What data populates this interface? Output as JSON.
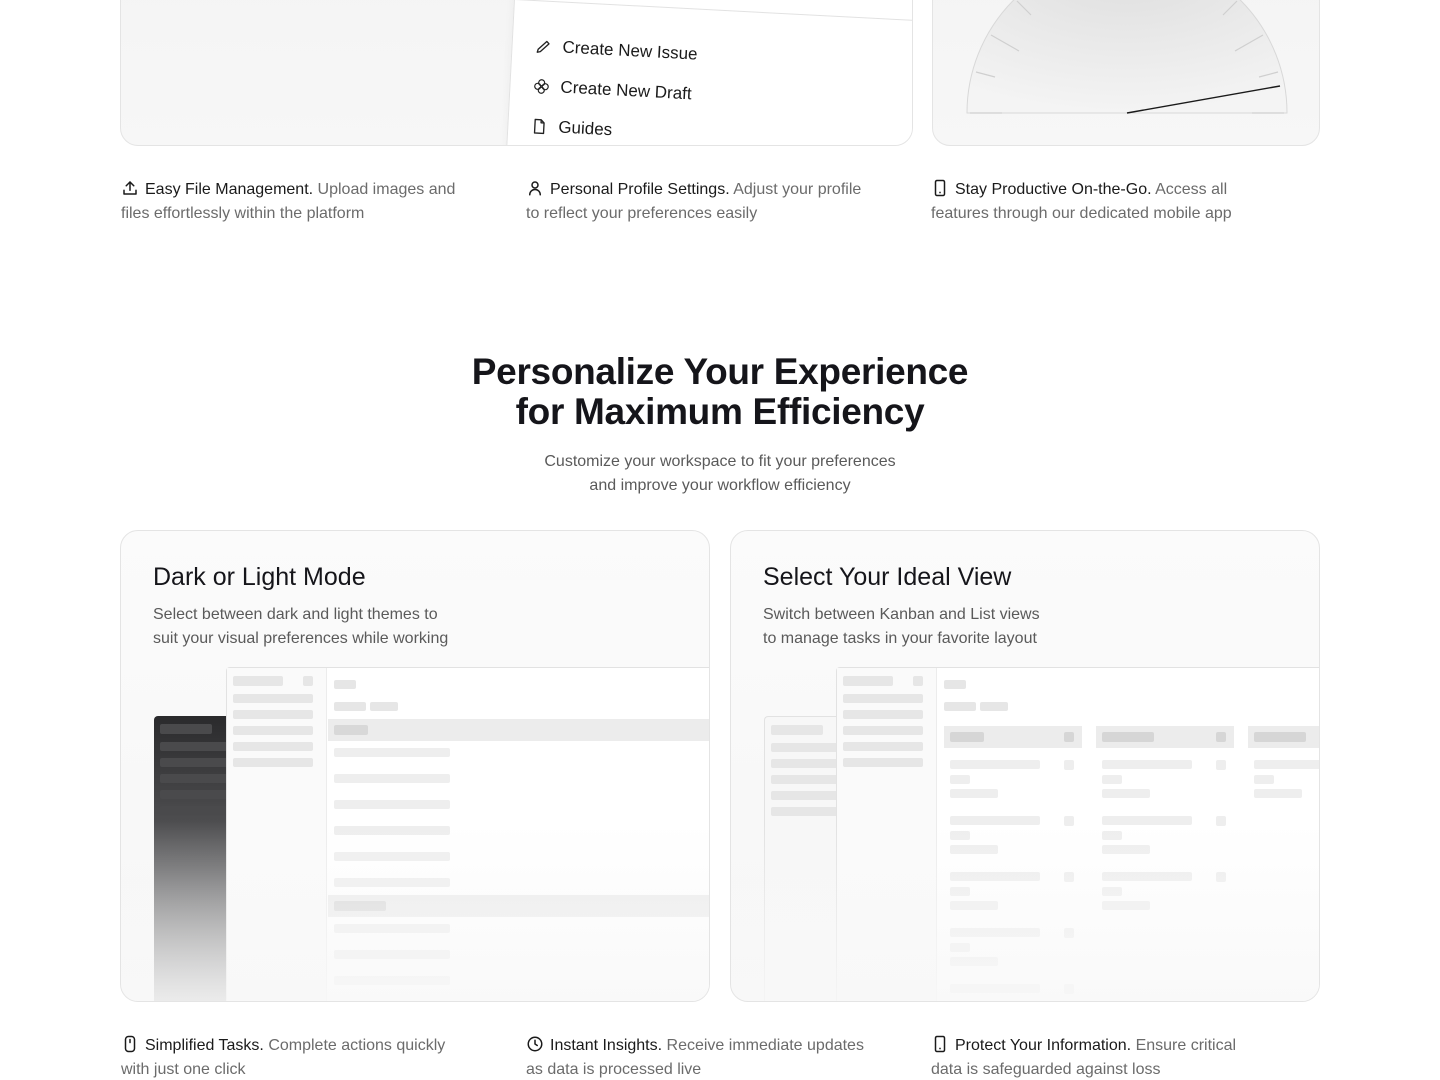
{
  "command_menu": {
    "items": [
      {
        "label": "Create New Issue",
        "icon": "pencil-icon"
      },
      {
        "label": "Create New Draft",
        "icon": "flower-icon"
      },
      {
        "label": "Guides",
        "icon": "document-icon"
      }
    ]
  },
  "top_features": [
    {
      "title": "Easy File Management.",
      "desc": "Upload images and files effortlessly within the platform",
      "icon": "upload-icon"
    },
    {
      "title": "Personal Profile Settings.",
      "desc": "Adjust your profile to reflect your preferences easily",
      "icon": "user-icon"
    },
    {
      "title": "Stay Productive On-the-Go.",
      "desc": "Access all features through our dedicated mobile app",
      "icon": "phone-icon"
    }
  ],
  "section": {
    "title_line1": "Personalize Your Experience",
    "title_line2": "for Maximum Efficiency",
    "subtitle_line1": "Customize your workspace to fit your preferences",
    "subtitle_line2": "and improve your workflow efficiency"
  },
  "cards": {
    "mode": {
      "title": "Dark or Light Mode",
      "desc_line1": "Select between dark and light themes to",
      "desc_line2": "suit your visual preferences while working"
    },
    "view": {
      "title": "Select Your Ideal View",
      "desc_line1": "Switch between Kanban and List views",
      "desc_line2": "to manage tasks in your favorite layout"
    }
  },
  "bottom_features": [
    {
      "title": "Simplified Tasks.",
      "desc": "Complete actions quickly with just one click",
      "icon": "mouse-icon"
    },
    {
      "title": "Instant Insights.",
      "desc": "Receive immediate updates as data is processed live",
      "icon": "clock-icon"
    },
    {
      "title": "Protect Your Information.",
      "desc": "Ensure critical data is safeguarded against loss",
      "icon": "phone-icon"
    }
  ]
}
